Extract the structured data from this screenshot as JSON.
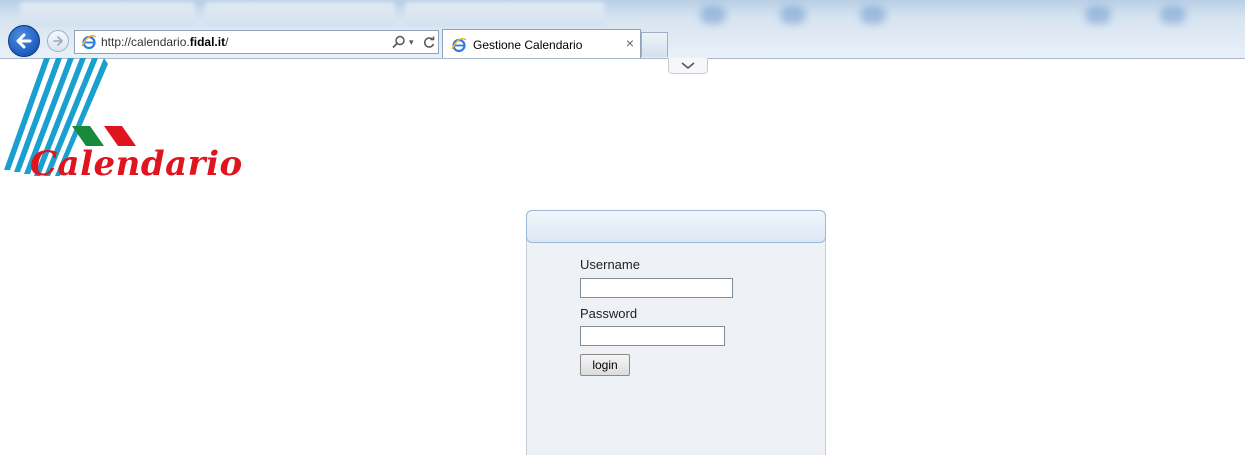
{
  "browser": {
    "url": {
      "prefix": "http://calendario.",
      "domain": "fidal.it",
      "suffix": "/"
    },
    "tab_title": "Gestione Calendario",
    "tab_close": "×",
    "search_dropdown": "▾"
  },
  "logo": {
    "text": "Calendario",
    "colors": {
      "stripes": "#1aa0cf",
      "green": "#1a8a3a",
      "red": "#e0141e"
    }
  },
  "login": {
    "username_label": "Username",
    "username_value": "",
    "password_label": "Password",
    "password_value": "",
    "button_label": "login"
  },
  "colors": {
    "accent_blue": "#1d5bbf",
    "panel_bg": "#eef2f6",
    "panel_header": "#dce8f4"
  }
}
